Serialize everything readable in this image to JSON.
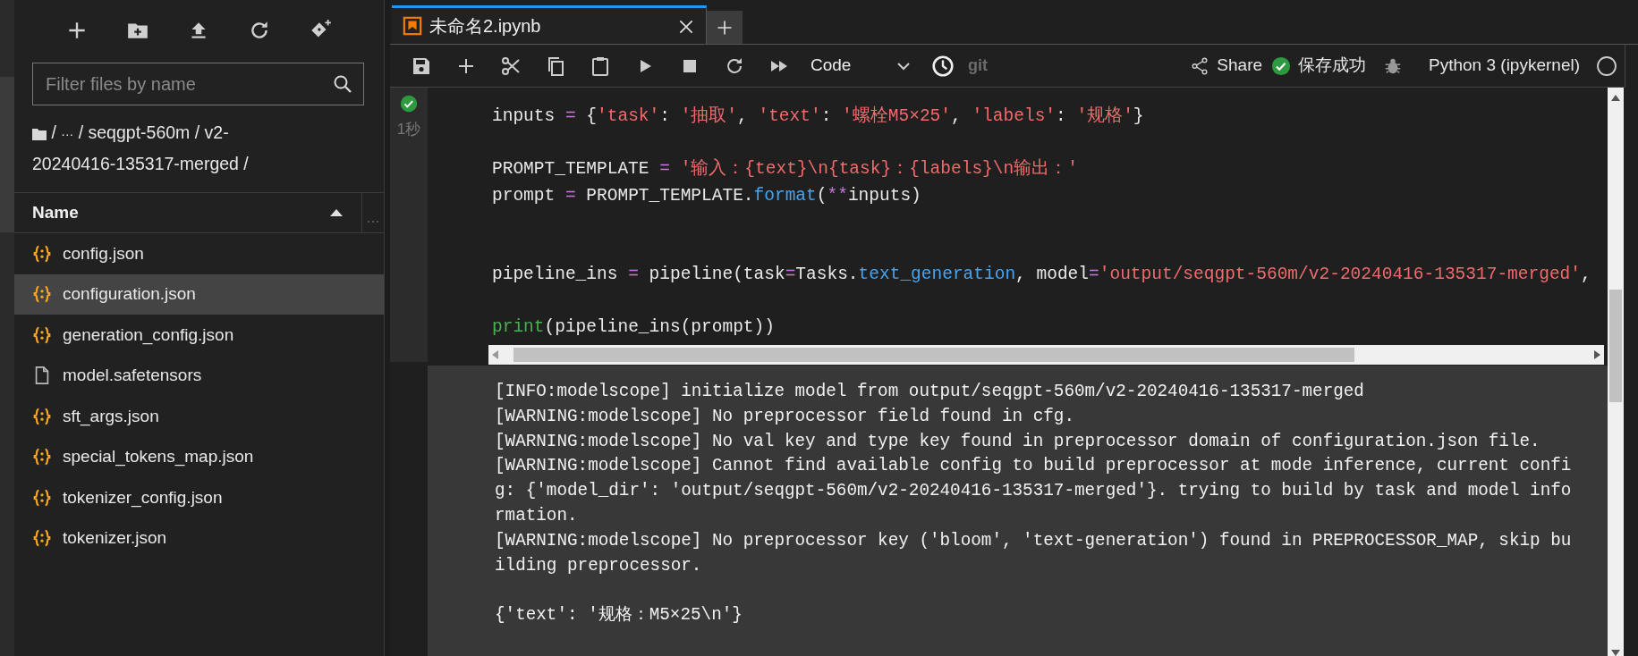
{
  "file_browser": {
    "filter": {
      "placeholder": "Filter files by name"
    },
    "breadcrumb": {
      "root": "/",
      "ellipsis": "···",
      "path": [
        "/ seqgpt-560m / v2-",
        "20240416-135317-merged /"
      ]
    },
    "column": {
      "label": "Name",
      "sort_ascending": true
    },
    "files": [
      {
        "name": "config.json",
        "kind": "json",
        "selected": false
      },
      {
        "name": "configuration.json",
        "kind": "json",
        "selected": true
      },
      {
        "name": "generation_config.json",
        "kind": "json",
        "selected": false
      },
      {
        "name": "model.safetensors",
        "kind": "file",
        "selected": false
      },
      {
        "name": "sft_args.json",
        "kind": "json",
        "selected": false
      },
      {
        "name": "special_tokens_map.json",
        "kind": "json",
        "selected": false
      },
      {
        "name": "tokenizer_config.json",
        "kind": "json",
        "selected": false
      },
      {
        "name": "tokenizer.json",
        "kind": "json",
        "selected": false
      }
    ]
  },
  "tabs": [
    {
      "title": "未命名2.ipynb",
      "selected": true
    }
  ],
  "toolbar": {
    "cell_type": "Code",
    "git": "git",
    "share": "Share",
    "save_status": "保存成功",
    "saved": true,
    "kernel": "Python 3 (ipykernel)",
    "kernel_busy": false
  },
  "cell": {
    "succeeded": true,
    "time": "1秒",
    "code": [
      {
        "kind": "line",
        "tokens": [
          {
            "kind": "name",
            "text": "inputs "
          },
          {
            "kind": "operator",
            "text": "="
          },
          {
            "kind": "name",
            "text": " {"
          },
          {
            "kind": "string",
            "text": "'task'"
          },
          {
            "kind": "name",
            "text": ": "
          },
          {
            "kind": "string",
            "text": "'抽取'"
          },
          {
            "kind": "name",
            "text": ", "
          },
          {
            "kind": "string",
            "text": "'text'"
          },
          {
            "kind": "name",
            "text": ": "
          },
          {
            "kind": "string",
            "text": "'螺栓M5×25'"
          },
          {
            "kind": "name",
            "text": ", "
          },
          {
            "kind": "string",
            "text": "'labels'"
          },
          {
            "kind": "name",
            "text": ": "
          },
          {
            "kind": "string",
            "text": "'规格'"
          },
          {
            "kind": "name",
            "text": "}"
          }
        ]
      },
      {
        "kind": "blank"
      },
      {
        "kind": "line",
        "tokens": [
          {
            "kind": "name",
            "text": "PROMPT_TEMPLATE "
          },
          {
            "kind": "operator",
            "text": "="
          },
          {
            "kind": "string",
            "text": " '输入：{text}\\n{task}：{labels}\\n输出：'"
          }
        ]
      },
      {
        "kind": "line",
        "tokens": [
          {
            "kind": "name",
            "text": "prompt "
          },
          {
            "kind": "operator",
            "text": "="
          },
          {
            "kind": "name",
            "text": " PROMPT_TEMPLATE."
          },
          {
            "kind": "method",
            "text": "format"
          },
          {
            "kind": "name",
            "text": "("
          },
          {
            "kind": "operator",
            "text": "**"
          },
          {
            "kind": "name",
            "text": "inputs)"
          }
        ]
      },
      {
        "kind": "blank"
      },
      {
        "kind": "blank"
      },
      {
        "kind": "line",
        "tokens": [
          {
            "kind": "name",
            "text": "pipeline_ins "
          },
          {
            "kind": "operator",
            "text": "="
          },
          {
            "kind": "name",
            "text": " pipeline(task"
          },
          {
            "kind": "operator",
            "text": "="
          },
          {
            "kind": "name",
            "text": "Tasks."
          },
          {
            "kind": "method",
            "text": "text_generation"
          },
          {
            "kind": "name",
            "text": ", model"
          },
          {
            "kind": "operator",
            "text": "="
          },
          {
            "kind": "string",
            "text": "'output/seqgpt-560m/v2-20240416-135317-merged'"
          },
          {
            "kind": "name",
            "text": ","
          }
        ]
      },
      {
        "kind": "blank"
      },
      {
        "kind": "line",
        "tokens": [
          {
            "kind": "builtin",
            "text": "print"
          },
          {
            "kind": "name",
            "text": "(pipeline_ins(prompt))"
          }
        ]
      }
    ],
    "output": [
      {
        "kind": "line",
        "text": "[INFO:modelscope] initialize model from output/seqgpt-560m/v2-20240416-135317-merged"
      },
      {
        "kind": "line",
        "text": "[WARNING:modelscope] No preprocessor field found in cfg."
      },
      {
        "kind": "line",
        "text": "[WARNING:modelscope] No val key and type key found in preprocessor domain of configuration.json file."
      },
      {
        "kind": "line",
        "text": "[WARNING:modelscope] Cannot find available config to build preprocessor at mode inference, current confi"
      },
      {
        "kind": "line",
        "text": "g: {'model_dir': 'output/seqgpt-560m/v2-20240416-135317-merged'}. trying to build by task and model info"
      },
      {
        "kind": "line",
        "text": "rmation."
      },
      {
        "kind": "line",
        "text": "[WARNING:modelscope] No preprocessor key ('bloom', 'text-generation') found in PREPROCESSOR_MAP, skip bu"
      },
      {
        "kind": "line",
        "text": "ilding preprocessor."
      },
      {
        "kind": "blank"
      },
      {
        "kind": "line",
        "text": "{'text': '规格：M5×25\\n'}"
      }
    ]
  }
}
